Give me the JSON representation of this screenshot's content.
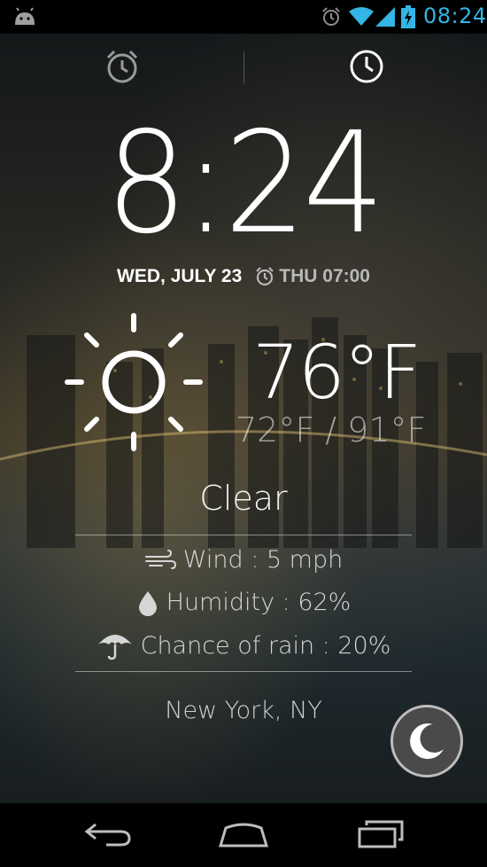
{
  "status_bar": {
    "time": "08:24",
    "accent_color": "#33b5e5",
    "icons": [
      "android-debug-icon",
      "alarm-icon",
      "wifi-icon",
      "signal-icon",
      "battery-charging-icon"
    ]
  },
  "tabs": {
    "left_icon": "alarm-clock-icon",
    "right_icon": "clock-icon"
  },
  "clock": {
    "time": "8:24",
    "date": "WED, JULY 23",
    "next_alarm": "THU 07:00"
  },
  "weather": {
    "icon": "sun-icon",
    "temperature": "76°F",
    "range": "72°F / 91°F",
    "condition": "Clear",
    "wind": "Wind : 5 mph",
    "humidity": "Humidity : 62%",
    "rain": "Chance of rain : 20%",
    "location": "New York, NY"
  },
  "night_mode": {
    "icon": "moon-icon"
  },
  "nav_bar": {
    "icons": [
      "back-icon",
      "home-icon",
      "recent-apps-icon"
    ]
  }
}
